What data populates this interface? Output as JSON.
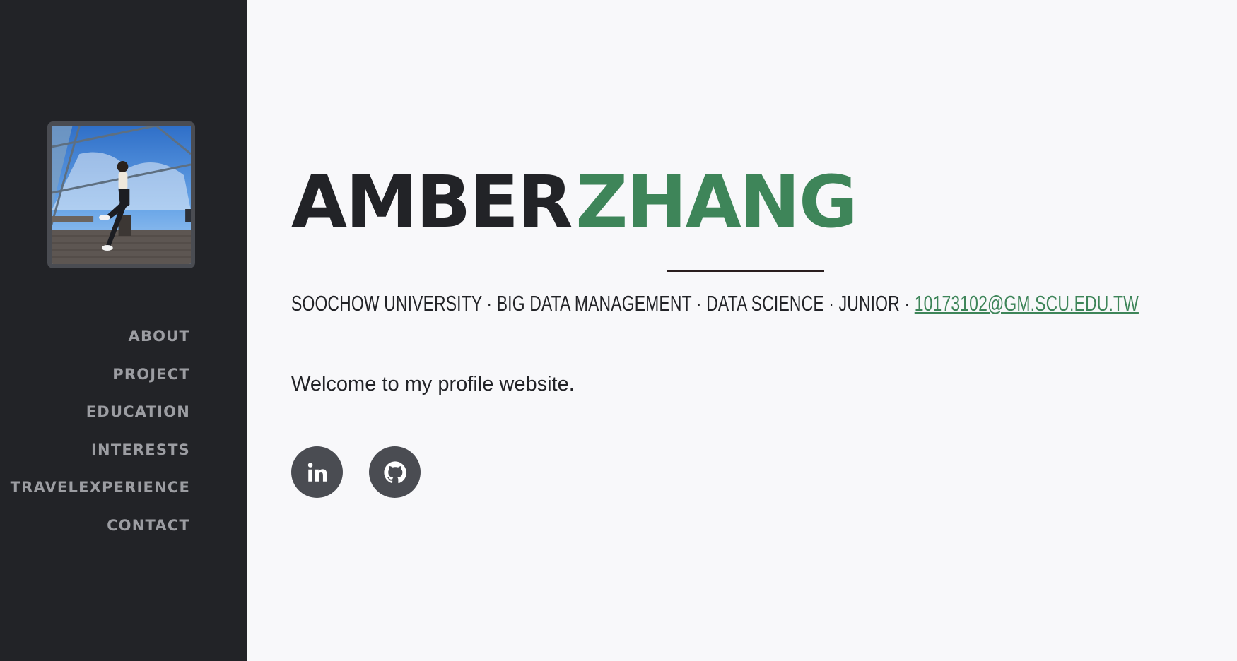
{
  "sidebar": {
    "nav": [
      {
        "label": "ABOUT"
      },
      {
        "label": "PROJECT"
      },
      {
        "label": "EDUCATION"
      },
      {
        "label": "INTERESTS"
      },
      {
        "label": "TRAVELEXPERIENCE"
      },
      {
        "label": "CONTACT"
      }
    ]
  },
  "header": {
    "first_name": "AMBER",
    "last_name": "ZHANG",
    "subheading": "SOOCHOW UNIVERSITY · BIG DATA MANAGEMENT · DATA SCIENCE · JUNIOR · ",
    "email": "10173102@GM.SCU.EDU.TW"
  },
  "intro": {
    "text": "Welcome to my profile website."
  },
  "social": [
    {
      "icon": "linkedin-icon"
    },
    {
      "icon": "github-icon"
    }
  ],
  "colors": {
    "sidebar_bg": "#222327",
    "accent": "#3e8559",
    "text": "#222327",
    "nav_text": "#9c9da2",
    "icon_bg": "#4a4c52"
  }
}
